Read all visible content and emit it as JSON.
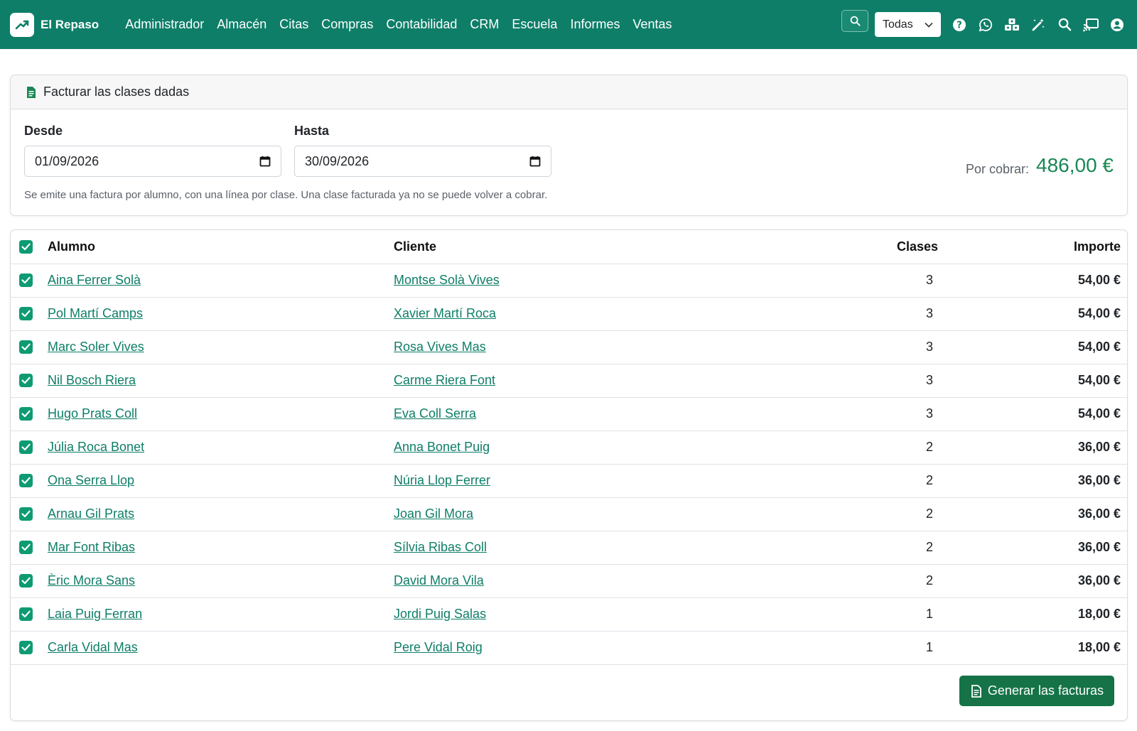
{
  "app": {
    "name": "El Repaso",
    "menu": [
      "Administrador",
      "Almacén",
      "Citas",
      "Compras",
      "Contabilidad",
      "CRM",
      "Escuela",
      "Informes",
      "Ventas"
    ],
    "company_select": "Todas",
    "icons": [
      "help-icon",
      "whatsapp-icon",
      "cubes-icon",
      "magic-wand-icon",
      "search-icon",
      "cast-icon",
      "user-icon"
    ]
  },
  "filter": {
    "title": "Facturar las clases dadas",
    "from_label": "Desde",
    "from_value": "01/09/2026",
    "to_label": "Hasta",
    "to_value": "30/09/2026",
    "help": "Se emite una factura por alumno, con una línea por clase. Una clase facturada ya no se puede volver a cobrar.",
    "total_label": "Por cobrar:",
    "total_value": "486,00 €"
  },
  "table": {
    "headers": {
      "alumno": "Alumno",
      "cliente": "Cliente",
      "clases": "Clases",
      "importe": "Importe"
    },
    "rows": [
      {
        "alumno": "Aina Ferrer Solà",
        "cliente": "Montse Solà Vives",
        "clases": "3",
        "importe": "54,00 €"
      },
      {
        "alumno": "Pol Martí Camps",
        "cliente": "Xavier Martí Roca",
        "clases": "3",
        "importe": "54,00 €"
      },
      {
        "alumno": "Marc Soler Vives",
        "cliente": "Rosa Vives Mas",
        "clases": "3",
        "importe": "54,00 €"
      },
      {
        "alumno": "Nil Bosch Riera",
        "cliente": "Carme Riera Font",
        "clases": "3",
        "importe": "54,00 €"
      },
      {
        "alumno": "Hugo Prats Coll",
        "cliente": "Eva Coll Serra",
        "clases": "3",
        "importe": "54,00 €"
      },
      {
        "alumno": "Júlia Roca Bonet",
        "cliente": "Anna Bonet Puig",
        "clases": "2",
        "importe": "36,00 €"
      },
      {
        "alumno": "Ona Serra Llop",
        "cliente": "Núria Llop Ferrer",
        "clases": "2",
        "importe": "36,00 €"
      },
      {
        "alumno": "Arnau Gil Prats",
        "cliente": "Joan Gil Mora",
        "clases": "2",
        "importe": "36,00 €"
      },
      {
        "alumno": "Mar Font Ribas",
        "cliente": "Sílvia Ribas Coll",
        "clases": "2",
        "importe": "36,00 €"
      },
      {
        "alumno": "Èric Mora Sans",
        "cliente": "David Mora Vila",
        "clases": "2",
        "importe": "36,00 €"
      },
      {
        "alumno": "Laia Puig Ferran",
        "cliente": "Jordi Puig Salas",
        "clases": "1",
        "importe": "18,00 €"
      },
      {
        "alumno": "Carla Vidal Mas",
        "cliente": "Pere Vidal Roig",
        "clases": "1",
        "importe": "18,00 €"
      }
    ]
  },
  "actions": {
    "generate": "Generar las facturas"
  },
  "colors": {
    "brand": "#0e7e68",
    "button": "#157347",
    "total": "#198754",
    "checkbox": "#0e9b73"
  }
}
